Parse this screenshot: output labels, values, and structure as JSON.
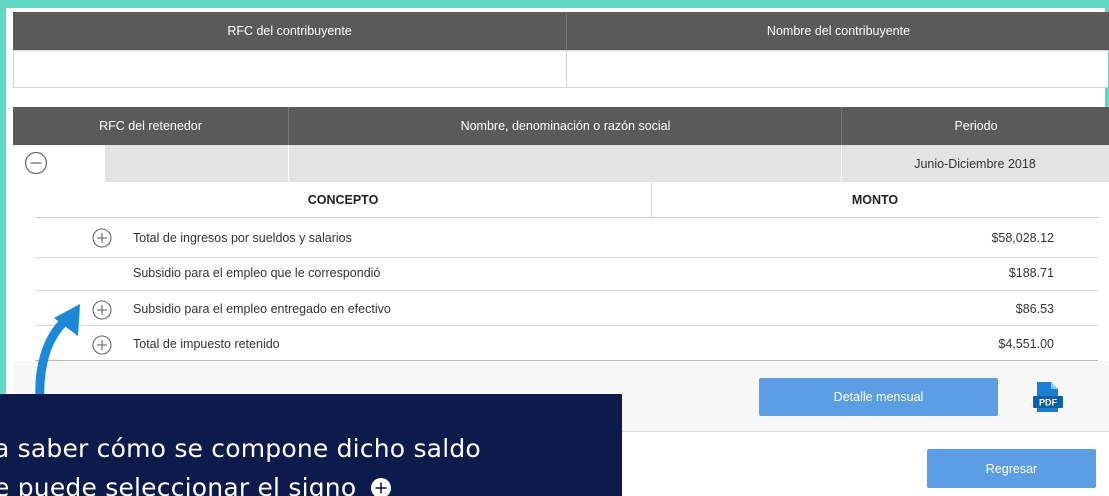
{
  "taxpayer_table": {
    "col_rfc": "RFC del contribuyente",
    "col_name": "Nombre del contribuyente"
  },
  "retainer_table": {
    "col_rfc": "RFC del retenedor",
    "col_name": "Nombre, denominación o razón social",
    "col_period": "Periodo",
    "period_value": "Junio-Diciembre 2018"
  },
  "concept_table": {
    "col_concept": "CONCEPTO",
    "col_amount": "MONTO",
    "rows": [
      {
        "label": "Total de ingresos por sueldos y salarios",
        "amount": "$58,028.12",
        "expandable": true
      },
      {
        "label": "Subsidio para el empleo que le correspondió",
        "amount": "$188.71",
        "expandable": false
      },
      {
        "label": "Subsidio para el empleo entregado en efectivo",
        "amount": "$86.53",
        "expandable": true
      },
      {
        "label": "Total de impuesto retenido",
        "amount": "$4,551.00",
        "expandable": true
      }
    ]
  },
  "buttons": {
    "monthly_detail": "Detalle mensual",
    "back": "Regresar",
    "pdf_label": "PDF"
  },
  "tooltip": {
    "line1": "a saber cómo se compone dicho saldo",
    "line2": "e puede seleccionar el signo"
  },
  "colors": {
    "header_bg": "#5a5a5a",
    "button_bg": "#5b9ee4",
    "tooltip_bg": "#0c1a4c",
    "accent_teal": "#5fd8c4",
    "arrow": "#1e88d8"
  }
}
